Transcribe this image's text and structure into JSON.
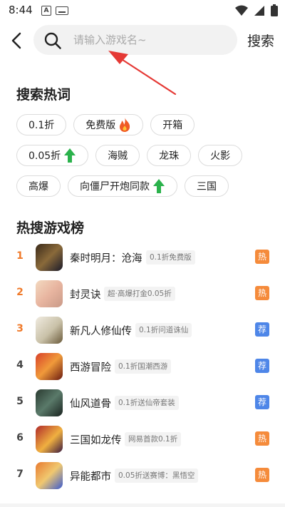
{
  "status_bar": {
    "time": "8:44"
  },
  "search": {
    "placeholder": "请输入游戏名~",
    "button_label": "搜索"
  },
  "hot_words": {
    "title": "搜索热词",
    "rows": [
      [
        {
          "label": "0.1折",
          "icon": ""
        },
        {
          "label": "免费版",
          "icon": "fire-icon"
        },
        {
          "label": "开箱",
          "icon": ""
        }
      ],
      [
        {
          "label": "0.05折",
          "icon": "up-arrow-icon"
        },
        {
          "label": "海贼",
          "icon": ""
        },
        {
          "label": "龙珠",
          "icon": ""
        },
        {
          "label": "火影",
          "icon": ""
        }
      ],
      [
        {
          "label": "高爆",
          "icon": ""
        },
        {
          "label": "向僵尸开炮同款",
          "icon": "up-arrow-icon"
        },
        {
          "label": "三国",
          "icon": ""
        }
      ]
    ]
  },
  "rank": {
    "title": "热搜游戏榜",
    "items": [
      {
        "rank": "1",
        "name": "秦时明月：沧海",
        "tag": "0.1折免费版",
        "badge": "热",
        "badge_type": "hot"
      },
      {
        "rank": "2",
        "name": "封灵诀",
        "tag": "超·高爆打金0.05折",
        "badge": "热",
        "badge_type": "hot"
      },
      {
        "rank": "3",
        "name": "新凡人修仙传",
        "tag": "0.1折问道诛仙",
        "badge": "荐",
        "badge_type": "rec"
      },
      {
        "rank": "4",
        "name": "西游冒险",
        "tag": "0.1折国潮西游",
        "badge": "荐",
        "badge_type": "rec"
      },
      {
        "rank": "5",
        "name": "仙风道骨",
        "tag": "0.1折送仙帝套装",
        "badge": "荐",
        "badge_type": "rec"
      },
      {
        "rank": "6",
        "name": "三国如龙传",
        "tag": "网易首款0.1折",
        "badge": "热",
        "badge_type": "hot"
      },
      {
        "rank": "7",
        "name": "异能都市",
        "tag": "0.05折送赛博：黑悟空",
        "badge": "热",
        "badge_type": "hot"
      }
    ]
  },
  "colors": {
    "accent_orange": "#f07a2a",
    "badge_hot": "#f58b3b",
    "badge_rec": "#4e86e8",
    "arrow_red": "#e53935",
    "trend_green": "#2bb24c"
  }
}
